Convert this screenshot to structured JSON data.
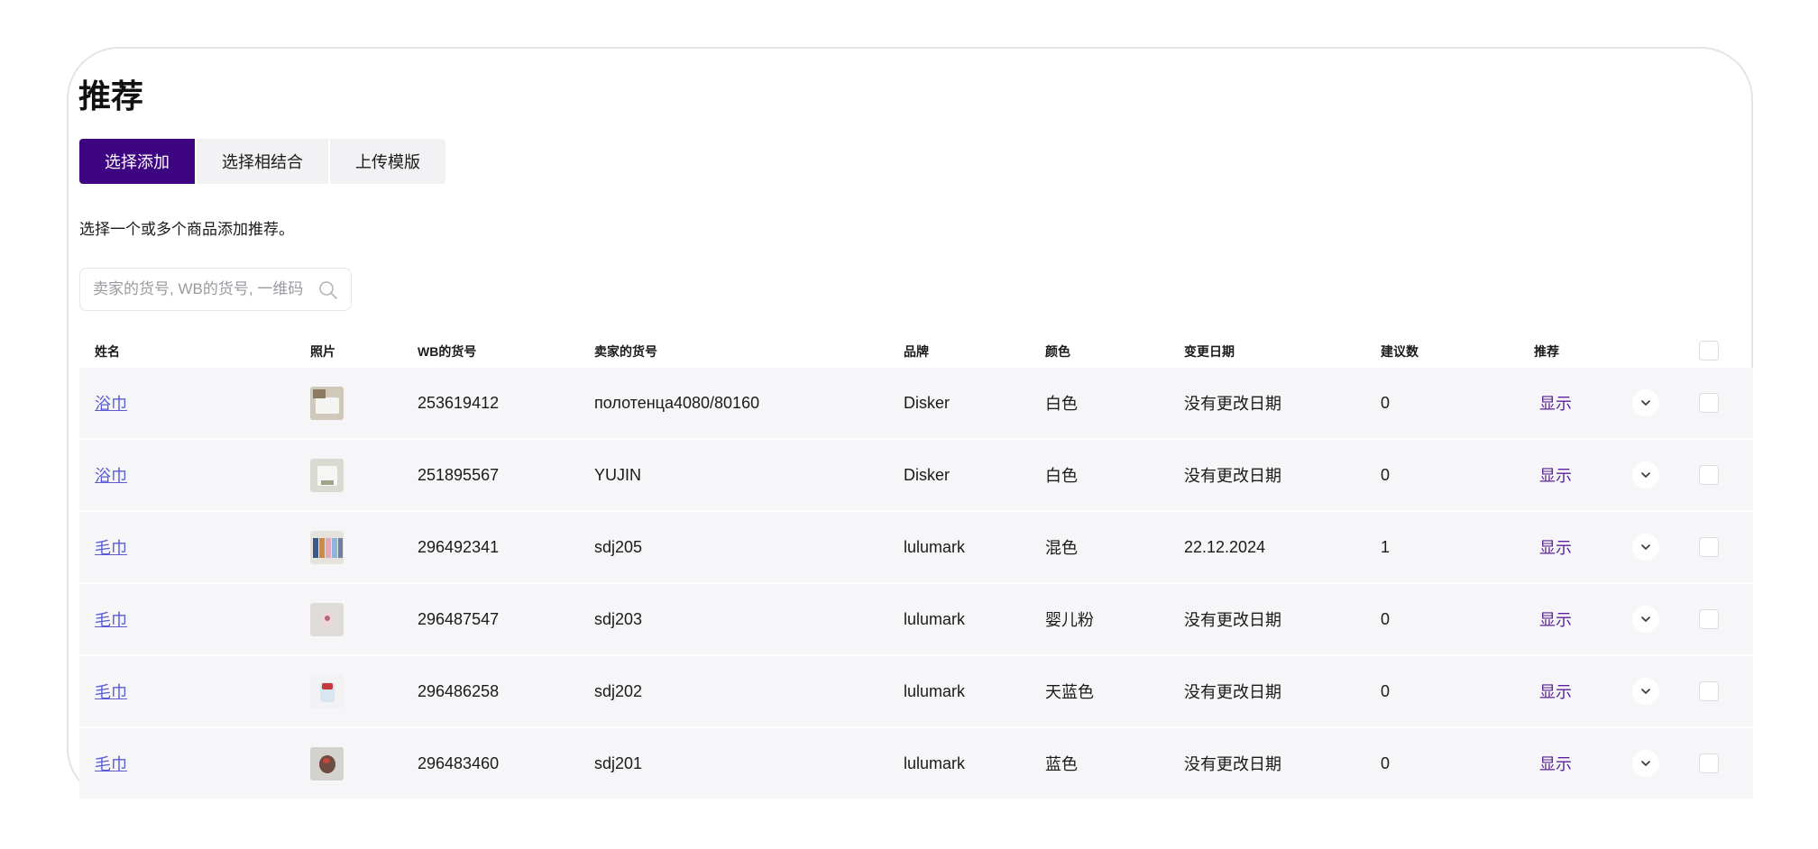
{
  "page": {
    "title": "推荐"
  },
  "tabs": [
    {
      "label": "选择添加",
      "active": true
    },
    {
      "label": "选择相结合",
      "active": false
    },
    {
      "label": "上传模版",
      "active": false
    }
  ],
  "description": "选择一个或多个商品添加推荐。",
  "search": {
    "placeholder": "卖家的货号, WB的货号, 一维码",
    "value": ""
  },
  "colors": {
    "accent": "#3e0580",
    "link": "#5b5bd6",
    "show_link": "#5a1f9e",
    "row_bg": "#f6f6f8"
  },
  "table": {
    "headers": {
      "name": "姓名",
      "photo": "照片",
      "wb_sku": "WB的货号",
      "seller_sku": "卖家的货号",
      "brand": "品牌",
      "color": "颜色",
      "change_date": "变更日期",
      "suggestions": "建议数",
      "recommend": "推荐"
    },
    "rows": [
      {
        "name": "浴巾",
        "photo_icon": "towel-product-thumbnail",
        "wb_sku": "253619412",
        "seller_sku": "полотенца4080/80160",
        "brand": "Disker",
        "color": "白色",
        "change_date": "没有更改日期",
        "suggestions": "0",
        "recommend": "显示"
      },
      {
        "name": "浴巾",
        "photo_icon": "towel-product-thumbnail",
        "wb_sku": "251895567",
        "seller_sku": "YUJIN",
        "brand": "Disker",
        "color": "白色",
        "change_date": "没有更改日期",
        "suggestions": "0",
        "recommend": "显示"
      },
      {
        "name": "毛巾",
        "photo_icon": "towel-product-thumbnail",
        "wb_sku": "296492341",
        "seller_sku": "sdj205",
        "brand": "lulumark",
        "color": "混色",
        "change_date": "22.12.2024",
        "suggestions": "1",
        "recommend": "显示"
      },
      {
        "name": "毛巾",
        "photo_icon": "towel-product-thumbnail",
        "wb_sku": "296487547",
        "seller_sku": "sdj203",
        "brand": "lulumark",
        "color": "婴儿粉",
        "change_date": "没有更改日期",
        "suggestions": "0",
        "recommend": "显示"
      },
      {
        "name": "毛巾",
        "photo_icon": "towel-product-thumbnail",
        "wb_sku": "296486258",
        "seller_sku": "sdj202",
        "brand": "lulumark",
        "color": "天蓝色",
        "change_date": "没有更改日期",
        "suggestions": "0",
        "recommend": "显示"
      },
      {
        "name": "毛巾",
        "photo_icon": "towel-product-thumbnail",
        "wb_sku": "296483460",
        "seller_sku": "sdj201",
        "brand": "lulumark",
        "color": "蓝色",
        "change_date": "没有更改日期",
        "suggestions": "0",
        "recommend": "显示"
      }
    ]
  }
}
